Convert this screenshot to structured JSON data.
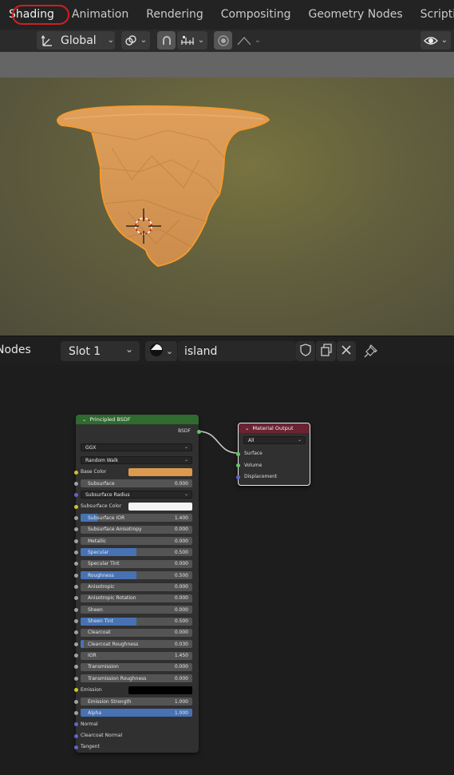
{
  "tabs": [
    "Shading",
    "Animation",
    "Rendering",
    "Compositing",
    "Geometry Nodes",
    "Scripting"
  ],
  "toolbar": {
    "orientation_label": "Global"
  },
  "node_editor": {
    "editor_label": "Nodes",
    "slot_label": "Slot 1",
    "material_name": "island"
  },
  "principled": {
    "title": "Principled BSDF",
    "output_label": "BSDF",
    "distribution": "GGX",
    "subsurface_method": "Random Walk",
    "base_color": "#dc9a4e",
    "subsurface_color": "#f4f4f4",
    "emission_color": "#000000",
    "rows": [
      {
        "type": "color",
        "label": "Base Color",
        "socket": "#c7c729",
        "color": "#dc9a4e"
      },
      {
        "type": "value",
        "label": "Subsurface",
        "value": "0.000",
        "fill": 0,
        "socket": "#a1a1a1"
      },
      {
        "type": "dropdown",
        "label": "Subsurface Radius",
        "socket": "#6363c7"
      },
      {
        "type": "color",
        "label": "Subsurface Color",
        "socket": "#c7c729",
        "color": "#f4f4f4"
      },
      {
        "type": "value",
        "label": "Subsurface IOR",
        "value": "1.400",
        "fill": 0.15,
        "socket": "#a1a1a1"
      },
      {
        "type": "value",
        "label": "Subsurface Anisotropy",
        "value": "0.000",
        "fill": 0,
        "socket": "#a1a1a1"
      },
      {
        "type": "value",
        "label": "Metallic",
        "value": "0.000",
        "fill": 0,
        "socket": "#a1a1a1"
      },
      {
        "type": "value",
        "label": "Specular",
        "value": "0.500",
        "fill": 0.5,
        "socket": "#a1a1a1"
      },
      {
        "type": "value",
        "label": "Specular Tint",
        "value": "0.000",
        "fill": 0,
        "socket": "#a1a1a1"
      },
      {
        "type": "value",
        "label": "Roughness",
        "value": "0.500",
        "fill": 0.5,
        "socket": "#a1a1a1"
      },
      {
        "type": "value",
        "label": "Anisotropic",
        "value": "0.000",
        "fill": 0,
        "socket": "#a1a1a1"
      },
      {
        "type": "value",
        "label": "Anisotropic Rotation",
        "value": "0.000",
        "fill": 0,
        "socket": "#a1a1a1"
      },
      {
        "type": "value",
        "label": "Sheen",
        "value": "0.000",
        "fill": 0,
        "socket": "#a1a1a1"
      },
      {
        "type": "value",
        "label": "Sheen Tint",
        "value": "0.500",
        "fill": 0.5,
        "socket": "#a1a1a1"
      },
      {
        "type": "value",
        "label": "Clearcoat",
        "value": "0.000",
        "fill": 0,
        "socket": "#a1a1a1"
      },
      {
        "type": "value",
        "label": "Clearcoat Roughness",
        "value": "0.030",
        "fill": 0.03,
        "socket": "#a1a1a1"
      },
      {
        "type": "value",
        "label": "IOR",
        "value": "1.450",
        "fill": 0,
        "socket": "#a1a1a1"
      },
      {
        "type": "value",
        "label": "Transmission",
        "value": "0.000",
        "fill": 0,
        "socket": "#a1a1a1"
      },
      {
        "type": "value",
        "label": "Transmission Roughness",
        "value": "0.000",
        "fill": 0,
        "socket": "#a1a1a1"
      },
      {
        "type": "color",
        "label": "Emission",
        "socket": "#c7c729",
        "color": "#000000"
      },
      {
        "type": "value",
        "label": "Emission Strength",
        "value": "1.000",
        "fill": 0,
        "socket": "#a1a1a1"
      },
      {
        "type": "value",
        "label": "Alpha",
        "value": "1.000",
        "fill": 1,
        "socket": "#a1a1a1"
      },
      {
        "type": "socket",
        "label": "Normal",
        "socket": "#6363c7"
      },
      {
        "type": "socket",
        "label": "Clearcoat Normal",
        "socket": "#6363c7"
      },
      {
        "type": "socket",
        "label": "Tangent",
        "socket": "#6363c7"
      }
    ]
  },
  "material_output": {
    "title": "Material Output",
    "target": "All",
    "inputs": [
      {
        "label": "Surface",
        "socket": "#63c763"
      },
      {
        "label": "Volume",
        "socket": "#63c763"
      },
      {
        "label": "Displacement",
        "socket": "#6363c7"
      }
    ]
  },
  "colors": {
    "shader_header": "#2f6a2f",
    "output_header": "#6b2333",
    "accent": "#4772b3",
    "selection_outline": "#f59a2d",
    "tab_highlight": "#d11f1f"
  }
}
